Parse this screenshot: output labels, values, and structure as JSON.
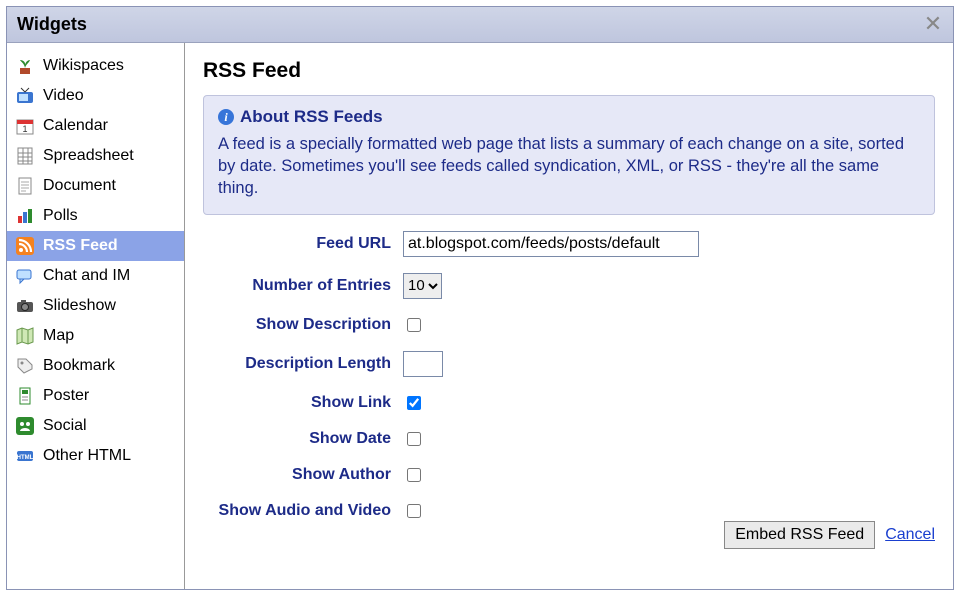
{
  "title": "Widgets",
  "sidebar": {
    "items": [
      {
        "label": "Wikispaces",
        "icon": "plant-icon"
      },
      {
        "label": "Video",
        "icon": "tv-icon"
      },
      {
        "label": "Calendar",
        "icon": "calendar-icon"
      },
      {
        "label": "Spreadsheet",
        "icon": "sheet-icon"
      },
      {
        "label": "Document",
        "icon": "doc-icon"
      },
      {
        "label": "Polls",
        "icon": "bars-icon"
      },
      {
        "label": "RSS Feed",
        "icon": "rss-icon",
        "selected": true
      },
      {
        "label": "Chat and IM",
        "icon": "chat-icon"
      },
      {
        "label": "Slideshow",
        "icon": "camera-icon"
      },
      {
        "label": "Map",
        "icon": "map-icon"
      },
      {
        "label": "Bookmark",
        "icon": "tag-icon"
      },
      {
        "label": "Poster",
        "icon": "poster-icon"
      },
      {
        "label": "Social",
        "icon": "social-icon"
      },
      {
        "label": "Other HTML",
        "icon": "html-icon"
      }
    ]
  },
  "main": {
    "heading": "RSS Feed",
    "about_title": "About RSS Feeds",
    "about_body": "A feed is a specially formatted web page that lists a summary of each change on a site, sorted by date. Sometimes you'll see feeds called syndication, XML, or RSS - they're all the same thing."
  },
  "form": {
    "feed_url_label": "Feed URL",
    "feed_url_value": "at.blogspot.com/feeds/posts/default",
    "num_entries_label": "Number of Entries",
    "num_entries_value": "10",
    "show_description_label": "Show Description",
    "show_description_checked": false,
    "description_length_label": "Description Length",
    "description_length_value": "",
    "show_link_label": "Show Link",
    "show_link_checked": true,
    "show_date_label": "Show Date",
    "show_date_checked": false,
    "show_author_label": "Show Author",
    "show_author_checked": false,
    "show_av_label": "Show Audio and Video",
    "show_av_checked": false
  },
  "footer": {
    "embed_label": "Embed RSS Feed",
    "cancel_label": "Cancel"
  }
}
